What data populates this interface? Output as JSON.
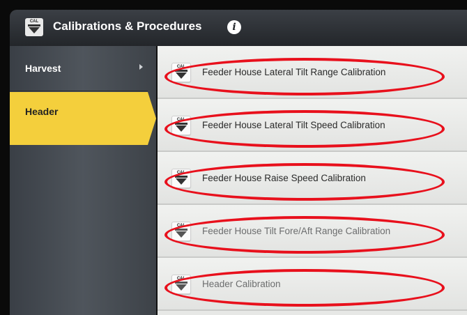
{
  "titlebar": {
    "title": "Calibrations & Procedures",
    "cal_badge": "CAL",
    "icon": "cal-icon",
    "info_icon": "info-icon",
    "info_glyph": "i"
  },
  "sidebar": {
    "items": [
      {
        "label": "Harvest",
        "selected": false,
        "has_arrow": true
      },
      {
        "label": "Header",
        "selected": true,
        "has_arrow": false
      }
    ]
  },
  "procedures": [
    {
      "label": "Feeder House Lateral Tilt Range Calibration",
      "badge": "CAL",
      "dimmed": false
    },
    {
      "label": "Feeder House Lateral Tilt Speed Calibration",
      "badge": "CAL",
      "dimmed": false
    },
    {
      "label": "Feeder House Raise Speed Calibration",
      "badge": "CAL",
      "dimmed": false
    },
    {
      "label": "Feeder House Tilt Fore/Aft Range Calibration",
      "badge": "CAL",
      "dimmed": true
    },
    {
      "label": "Header Calibration",
      "badge": "CAL",
      "dimmed": true
    }
  ],
  "colors": {
    "selected_tab": "#f4cf3c",
    "highlight_oval": "#e8101c",
    "titlebar": "#2c3035",
    "sidebar": "#464b51"
  }
}
